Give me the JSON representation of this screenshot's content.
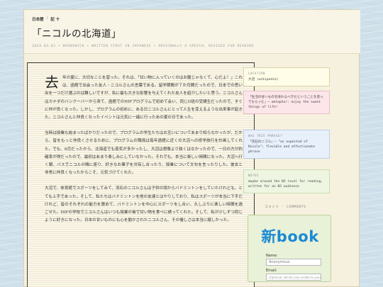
{
  "breadcrumb": {
    "home": "日本語",
    "sep": "/",
    "section": "記 十"
  },
  "title": "「ニコルの北海道」",
  "meta": "2024.03.02 • BRUNSWICK • WRITTEN FIRST IN JAPANESE • ORIGINALLY A SPEECH, REVISED FOR READING",
  "article": {
    "dropcap": "去",
    "para1": "年の夏に、大切なことを習った。それは、「甘い物に入っていくのはお腹じゃなくて、心だよ！」これは、函館で出会った友人・ニコルさんの言葉である。留学期間が７か月間だったので、日本での思い出を一つだけ選ぶのは難しいですが、私に最も大きな影響を与えてくれた友人を紹介したいと思う。ニコルさんはカナダのバンクーバーから来て、函館でのHIFプログラムで初めて会い、同じD班の受講生だったので、すぐに仲が良くなった。しかし、プログラムの初めに、ある日ニコルさんにとって人生を変えるような出来事が起きた。ニコルさんと仲良くなったイベントは元気に一緒に行ったあの夏の日であった。",
    "para2": "当時は授業も始まったばかりだったので、プログラムの学生たちはお互いについてあまり知らなかったが、だから、皆をもっと仲良くさせるために、プログラムの職員は毎年函館に近くの大沼への修学旅行を計画してくれた。でも、6月だったから、北海道でも蒸気が多かったし、大沼は想像より狭くはなかったので、一日の方が約確率が得だったので、最初はあまり楽しみにしていなかった。それでも、本当に楽しい時間になった。大沼へ行く朝、バスでニコルの隣に座り、好きなお菓子を共有し合ったり、授業について文句を言ったりした。彼女と非常に仲良くなったからこそ、元気づけてくれた。",
    "para3": "大沼で、体育館でスポーツをしてみて、流石のニコルさんは子供の頃からバドミントンをしていたけれども、とても上手であった。そして、私たちはバドミントンを他の友達とはやりしており、私はスポーツが本当に下手だけれど、皆のそれぞれの能力を褒めて、バドミントンを中心にスポーツをし合い、久しぶりに楽しい時間を過ごせた。HIFの学校でニコルさんはいつも授業の後で甘い物を食べに誘ってくれた。そして、私が少しずつ同じように好きになった。日本の甘いものにも心を動かされたニコルさん、その優しさは本当に嬉しかった。"
  },
  "sidebar": {
    "location_label": "LOCATION",
    "location_value": "大沼 (wikipedia)",
    "quote_text": "「生活の甘いものを味わるべきだということを習ってもらった」— metaphor: enjoy the sweet things of life!",
    "wordsense_label": "WAS THIS PHRASE?",
    "wordsense_text": "「流石のニコル」— \"as expected of Nicole\"; flexible and affectionate phrase",
    "notes_label": "NOTES",
    "notes_text": "maybe around the N3 level for reading, written for an N3 audience",
    "comments_label": "コメント · COMMENTS"
  },
  "newbook": {
    "logo": "新book",
    "name_label": "Name:",
    "name_value": "Anonymous",
    "email_label": "Email:",
    "email_placeholder": "(Optional, will be only visible to yourself)"
  },
  "colors": {
    "background": "#cfe0ea",
    "paper": "#f6f1df",
    "logo": "#1b8ad4"
  }
}
